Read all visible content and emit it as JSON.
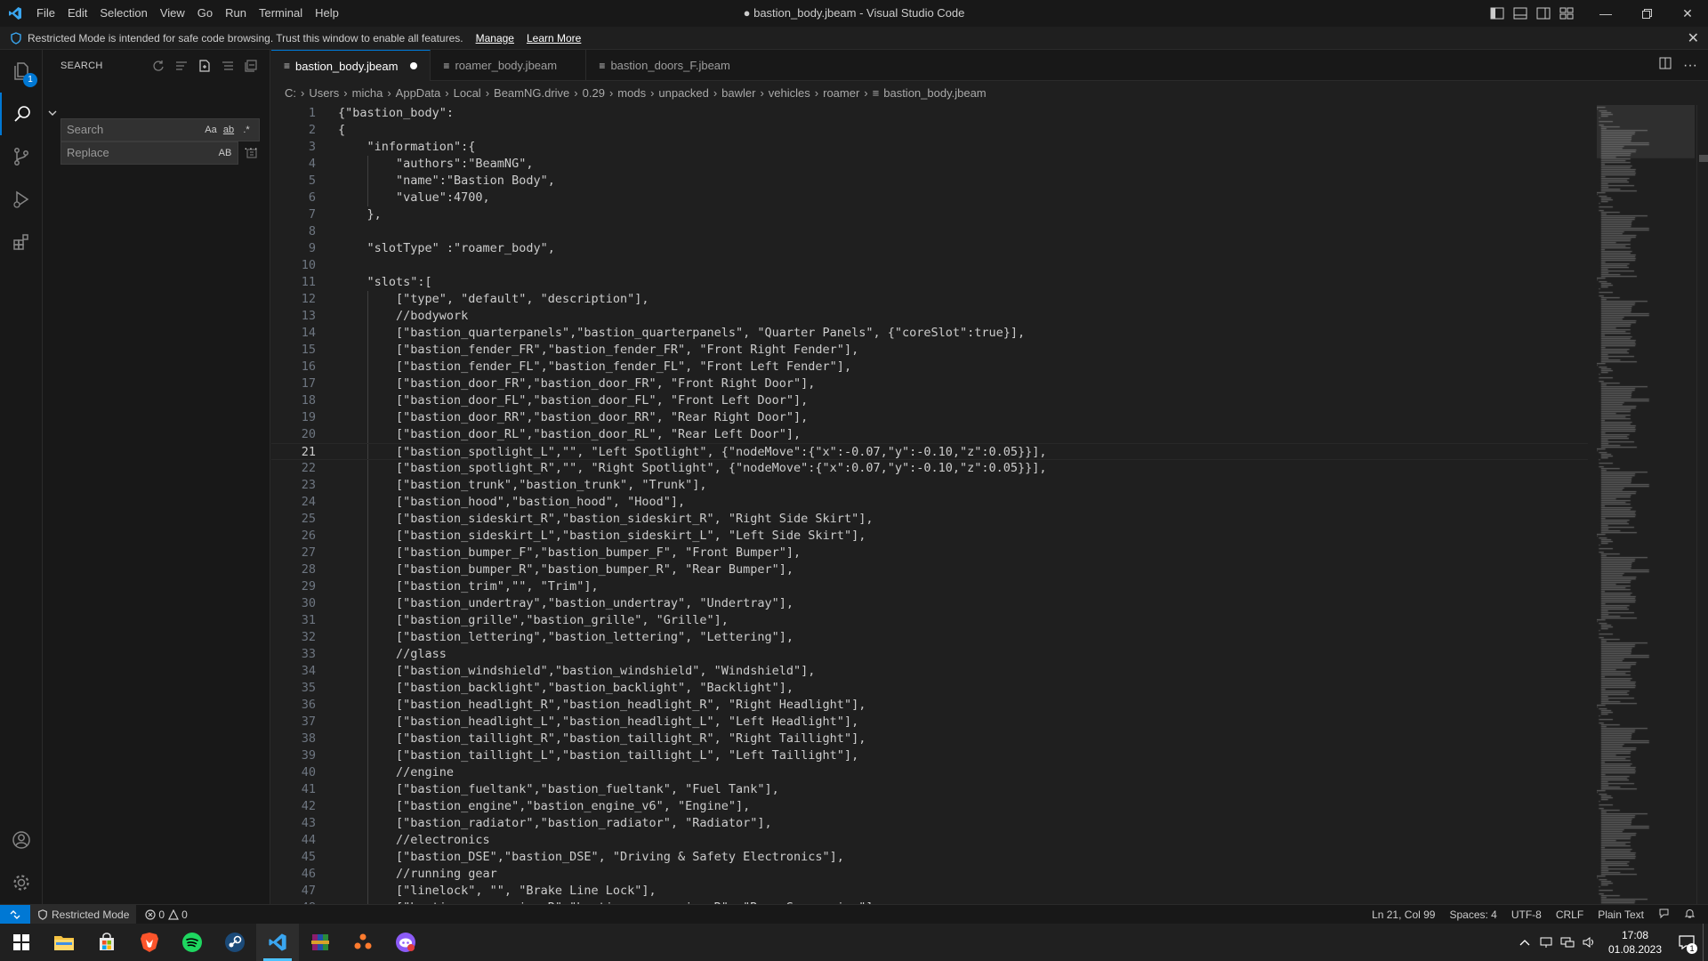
{
  "titlebar": {
    "title": "● bastion_body.jbeam - Visual Studio Code",
    "menu": [
      "File",
      "Edit",
      "Selection",
      "View",
      "Go",
      "Run",
      "Terminal",
      "Help"
    ]
  },
  "banner": {
    "text": "Restricted Mode is intended for safe code browsing. Trust this window to enable all features.",
    "manage": "Manage",
    "learn_more": "Learn More"
  },
  "activitybar": {
    "explorer_badge": "1"
  },
  "sidebar": {
    "title": "SEARCH",
    "search_placeholder": "Search",
    "replace_placeholder": "Replace",
    "options": [
      "Aa",
      "ab",
      ".*"
    ],
    "replace_option": "AB"
  },
  "tabs": [
    {
      "label": "bastion_body.jbeam",
      "active": true,
      "modified": true
    },
    {
      "label": "roamer_body.jbeam",
      "active": false,
      "modified": false
    },
    {
      "label": "bastion_doors_F.jbeam",
      "active": false,
      "modified": false
    }
  ],
  "breadcrumb": [
    "C:",
    "Users",
    "micha",
    "AppData",
    "Local",
    "BeamNG.drive",
    "0.29",
    "mods",
    "unpacked",
    "bawler",
    "vehicles",
    "roamer",
    "bastion_body.jbeam"
  ],
  "code": {
    "current_line": 21,
    "lines": [
      "{\"bastion_body\":",
      "{",
      "    \"information\":{",
      "        \"authors\":\"BeamNG\",",
      "        \"name\":\"Bastion Body\",",
      "        \"value\":4700,",
      "    },",
      "",
      "    \"slotType\" :\"roamer_body\",",
      "",
      "    \"slots\":[",
      "        [\"type\", \"default\", \"description\"],",
      "        //bodywork",
      "        [\"bastion_quarterpanels\",\"bastion_quarterpanels\", \"Quarter Panels\", {\"coreSlot\":true}],",
      "        [\"bastion_fender_FR\",\"bastion_fender_FR\", \"Front Right Fender\"],",
      "        [\"bastion_fender_FL\",\"bastion_fender_FL\", \"Front Left Fender\"],",
      "        [\"bastion_door_FR\",\"bastion_door_FR\", \"Front Right Door\"],",
      "        [\"bastion_door_FL\",\"bastion_door_FL\", \"Front Left Door\"],",
      "        [\"bastion_door_RR\",\"bastion_door_RR\", \"Rear Right Door\"],",
      "        [\"bastion_door_RL\",\"bastion_door_RL\", \"Rear Left Door\"],",
      "        [\"bastion_spotlight_L\",\"\", \"Left Spotlight\", {\"nodeMove\":{\"x\":-0.07,\"y\":-0.10,\"z\":0.05}}],",
      "        [\"bastion_spotlight_R\",\"\", \"Right Spotlight\", {\"nodeMove\":{\"x\":0.07,\"y\":-0.10,\"z\":0.05}}],",
      "        [\"bastion_trunk\",\"bastion_trunk\", \"Trunk\"],",
      "        [\"bastion_hood\",\"bastion_hood\", \"Hood\"],",
      "        [\"bastion_sideskirt_R\",\"bastion_sideskirt_R\", \"Right Side Skirt\"],",
      "        [\"bastion_sideskirt_L\",\"bastion_sideskirt_L\", \"Left Side Skirt\"],",
      "        [\"bastion_bumper_F\",\"bastion_bumper_F\", \"Front Bumper\"],",
      "        [\"bastion_bumper_R\",\"bastion_bumper_R\", \"Rear Bumper\"],",
      "        [\"bastion_trim\",\"\", \"Trim\"],",
      "        [\"bastion_undertray\",\"bastion_undertray\", \"Undertray\"],",
      "        [\"bastion_grille\",\"bastion_grille\", \"Grille\"],",
      "        [\"bastion_lettering\",\"bastion_lettering\", \"Lettering\"],",
      "        //glass",
      "        [\"bastion_windshield\",\"bastion_windshield\", \"Windshield\"],",
      "        [\"bastion_backlight\",\"bastion_backlight\", \"Backlight\"],",
      "        [\"bastion_headlight_R\",\"bastion_headlight_R\", \"Right Headlight\"],",
      "        [\"bastion_headlight_L\",\"bastion_headlight_L\", \"Left Headlight\"],",
      "        [\"bastion_taillight_R\",\"bastion_taillight_R\", \"Right Taillight\"],",
      "        [\"bastion_taillight_L\",\"bastion_taillight_L\", \"Left Taillight\"],",
      "        //engine",
      "        [\"bastion_fueltank\",\"bastion_fueltank\", \"Fuel Tank\"],",
      "        [\"bastion_engine\",\"bastion_engine_v6\", \"Engine\"],",
      "        [\"bastion_radiator\",\"bastion_radiator\", \"Radiator\"],",
      "        //electronics",
      "        [\"bastion_DSE\",\"bastion_DSE\", \"Driving & Safety Electronics\"],",
      "        //running gear",
      "        [\"linelock\", \"\", \"Brake Line Lock\"],",
      "        [\"bastion_suspension_R\",\"bastion_suspension_R\", \"Rear Suspension\"],"
    ]
  },
  "statusbar": {
    "restricted": "Restricted Mode",
    "errors": "0",
    "warnings": "0",
    "position": "Ln 21, Col 99",
    "spaces": "Spaces: 4",
    "encoding": "UTF-8",
    "eol": "CRLF",
    "language": "Plain Text"
  },
  "taskbar": {
    "time": "17:08",
    "date": "01.08.2023",
    "notifications": "1",
    "colors": {
      "accent": "#0078d4",
      "brave": "#fb542b",
      "spotify": "#1ed760"
    }
  }
}
